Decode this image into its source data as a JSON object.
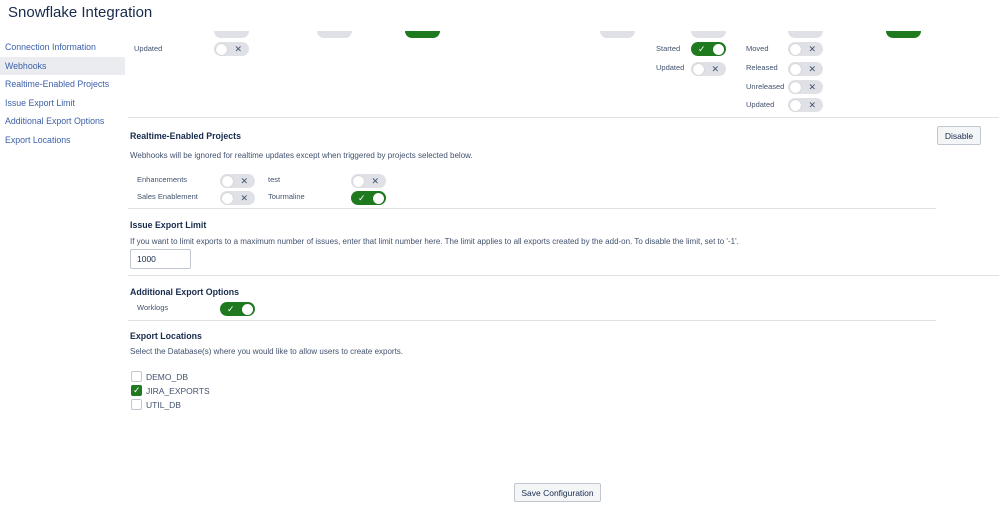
{
  "app": {
    "title": "Snowflake Integration"
  },
  "sidebar": {
    "items": [
      {
        "label": "Connection Information"
      },
      {
        "label": "Webhooks"
      },
      {
        "label": "Realtime-Enabled Projects"
      },
      {
        "label": "Issue Export Limit"
      },
      {
        "label": "Additional Export Options"
      },
      {
        "label": "Export Locations"
      }
    ]
  },
  "webhooks": {
    "rows": [
      {
        "label": "Updated",
        "state": "off"
      },
      {
        "label": "Started",
        "state": "on"
      },
      {
        "label": "Updated",
        "state": "off"
      },
      {
        "label": "Moved",
        "state": "off"
      },
      {
        "label": "Released",
        "state": "off"
      },
      {
        "label": "Unreleased",
        "state": "off"
      },
      {
        "label": "Updated",
        "state": "off"
      }
    ]
  },
  "toggle_marks": {
    "on": "✓",
    "off": "✕"
  },
  "realtime": {
    "title": "Realtime-Enabled Projects",
    "disable_label": "Disable",
    "description": "Webhooks will be ignored for realtime updates except when triggered by projects selected below.",
    "projects": [
      {
        "label": "Enhancements",
        "state": "off"
      },
      {
        "label": "Sales Enablement",
        "state": "off"
      },
      {
        "label": "test",
        "state": "off"
      },
      {
        "label": "Tourmaline",
        "state": "on"
      }
    ]
  },
  "export_limit": {
    "title": "Issue Export Limit",
    "description": "If you want to limit exports to a maximum number of issues, enter that limit number here. The limit applies to all exports created by the add-on. To disable the limit, set to '-1'.",
    "value": "1000"
  },
  "additional": {
    "title": "Additional Export Options",
    "options": [
      {
        "label": "Worklogs",
        "state": "on"
      }
    ]
  },
  "locations": {
    "title": "Export Locations",
    "description": "Select the Database(s) where you would like to allow users to create exports.",
    "databases": [
      {
        "label": "DEMO_DB",
        "checked": false
      },
      {
        "label": "JIRA_EXPORTS",
        "checked": true
      },
      {
        "label": "UTIL_DB",
        "checked": false
      }
    ]
  },
  "footer": {
    "save_label": "Save Configuration"
  },
  "colors": {
    "accent": "#1f7a1f",
    "link": "#3b5fa8",
    "text": "#172b4d"
  }
}
